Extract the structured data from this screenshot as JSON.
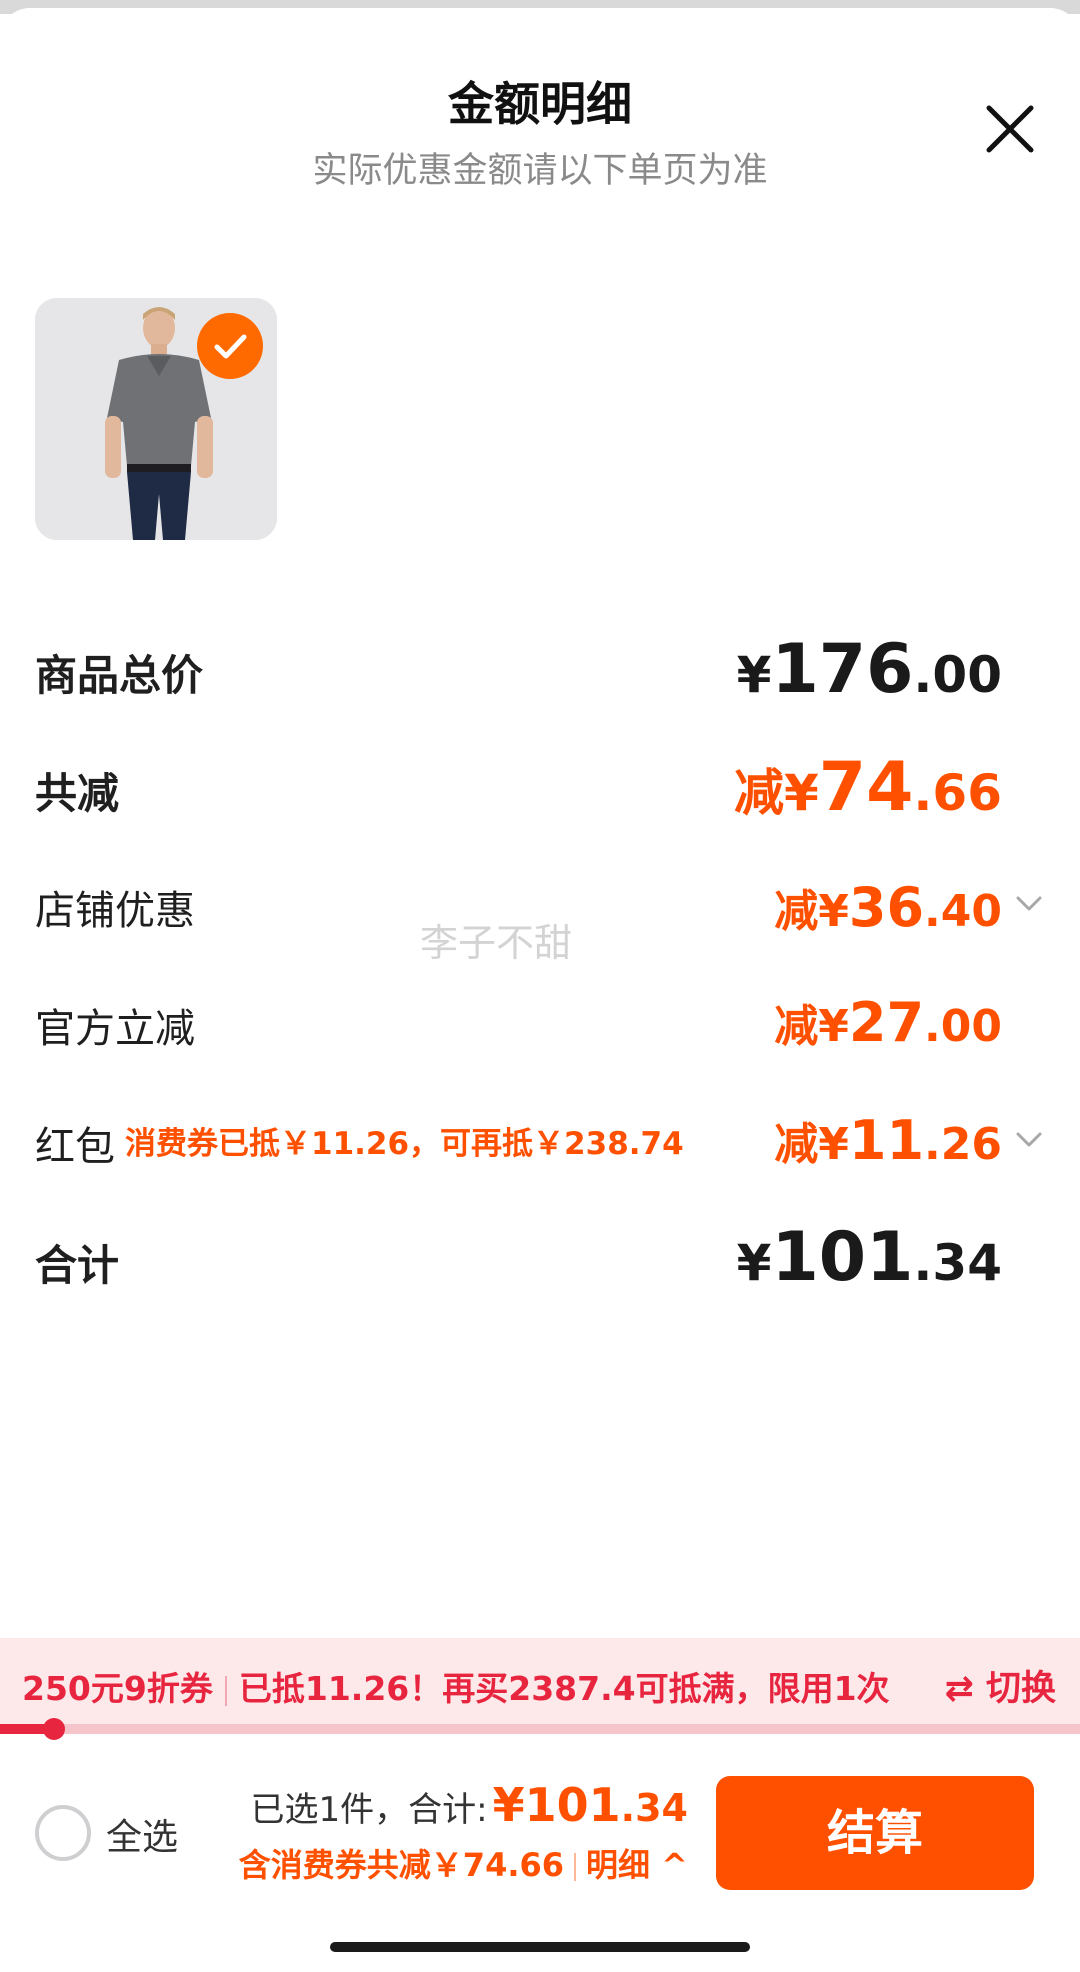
{
  "header": {
    "title": "金额明细",
    "subtitle": "实际优惠金额请以下单页为准"
  },
  "product": {
    "selected": true
  },
  "breakdown": {
    "goods_total": {
      "label": "商品总价",
      "yen": "¥",
      "int": "176",
      "dec": ".00"
    },
    "total_discount": {
      "label": "共减",
      "prefix": "减¥",
      "int": "74",
      "dec": ".66"
    },
    "shop_discount": {
      "label": "店铺优惠",
      "prefix": "减¥",
      "int": "36",
      "dec": ".40"
    },
    "official_discount": {
      "label": "官方立减",
      "prefix": "减¥",
      "int": "27",
      "dec": ".00"
    },
    "red_packet": {
      "label": "红包",
      "note": "消费券已抵￥11.26，可再抵￥238.74",
      "prefix": "减¥",
      "int": "11",
      "dec": ".26"
    },
    "grand_total": {
      "label": "合计",
      "yen": "¥",
      "int": "101",
      "dec": ".34"
    }
  },
  "watermark": "李子不甜",
  "coupon_bar": {
    "coupon_name": "250元9折券",
    "message": "已抵11.26！再买2387.4可抵满，限用1次",
    "switch_label": "⇄ 切换",
    "progress": 0.05
  },
  "footer": {
    "select_all": "全选",
    "selected_text": "已选1件，合计:",
    "total_int": "¥101",
    "total_dec": ".34",
    "discount_text": "含消费券共减￥74.66",
    "detail_label": "明细 ^",
    "checkout_label": "结算"
  },
  "colors": {
    "accent": "#ff5000",
    "coupon_red": "#e8253f",
    "coupon_bg": "#fde8ea"
  }
}
